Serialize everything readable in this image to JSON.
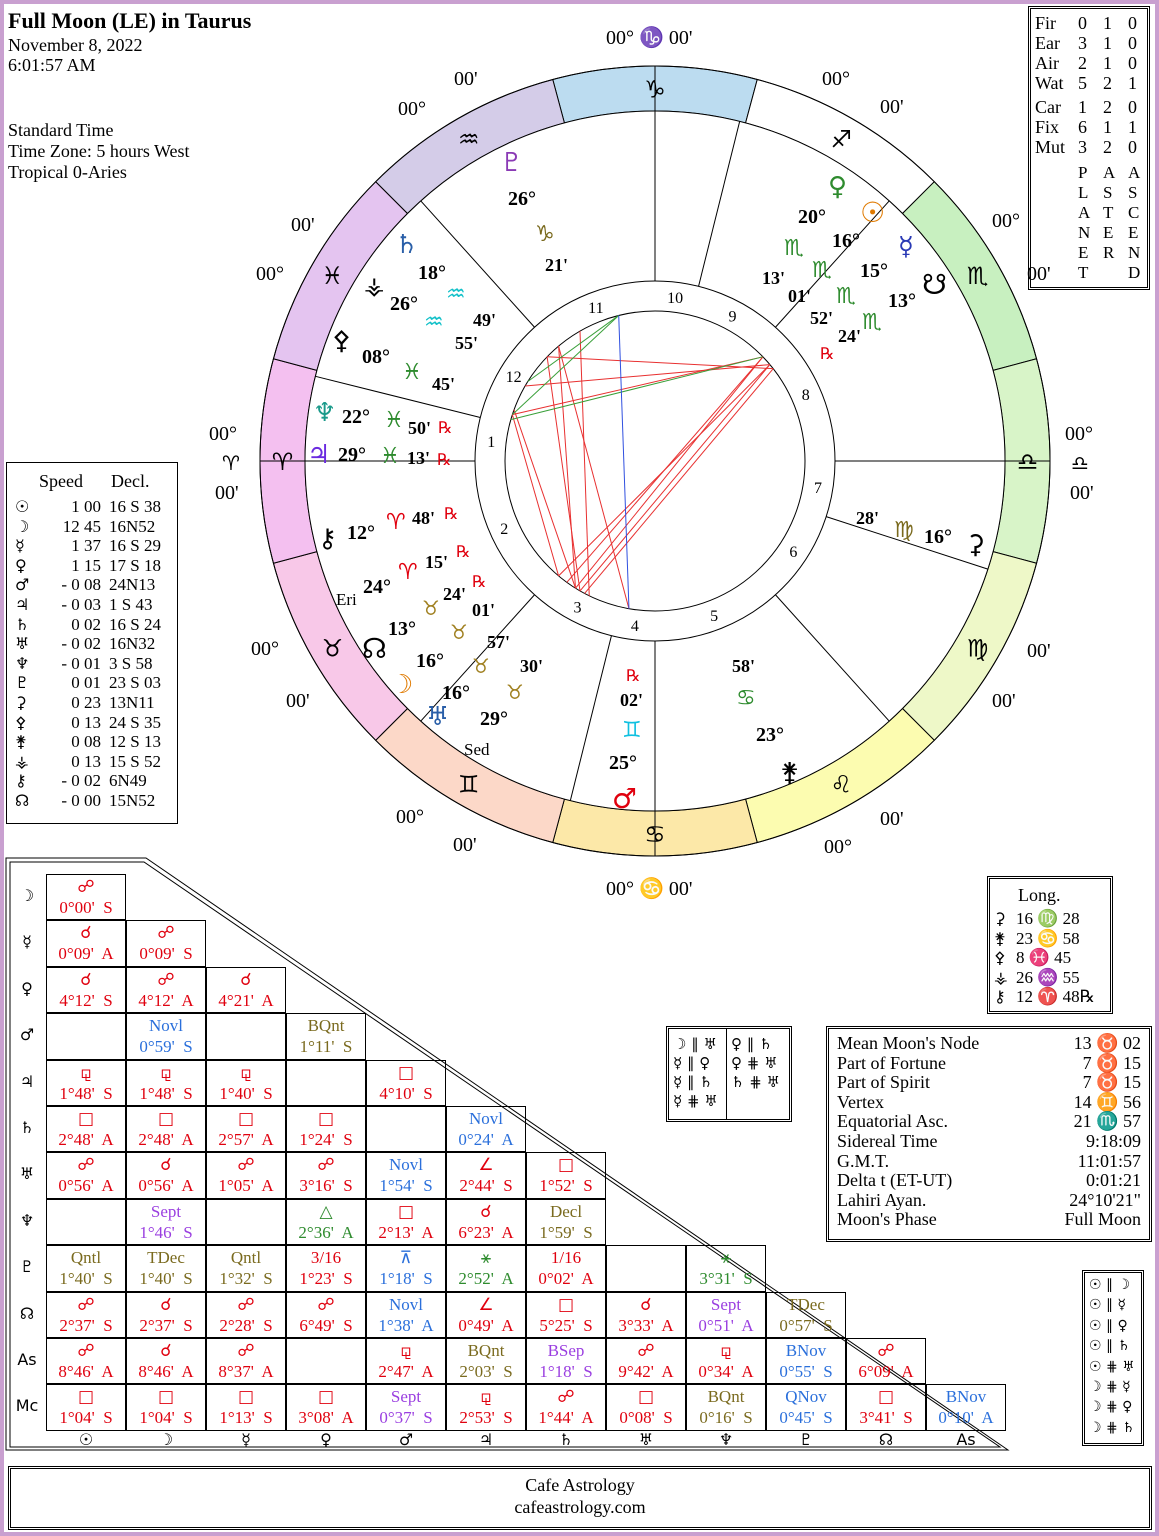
{
  "header": {
    "title": "Full Moon (LE)  in Taurus",
    "date": "November 8, 2022",
    "time": "6:01:57 AM",
    "standard": "Standard Time",
    "zone": "Time Zone: 5 hours West",
    "zodiac": "Tropical 0-Aries"
  },
  "elements_table": {
    "rows": [
      {
        "label": "Fir",
        "a": "0",
        "b": "1",
        "c": "0"
      },
      {
        "label": "Ear",
        "a": "3",
        "b": "1",
        "c": "0"
      },
      {
        "label": "Air",
        "a": "2",
        "b": "1",
        "c": "0"
      },
      {
        "label": "Wat",
        "a": "5",
        "b": "2",
        "c": "1"
      },
      {
        "label": "Car",
        "a": "1",
        "b": "2",
        "c": "0"
      },
      {
        "label": "Fix",
        "a": "6",
        "b": "1",
        "c": "1"
      },
      {
        "label": "Mut",
        "a": "3",
        "b": "2",
        "c": "0"
      }
    ],
    "col_a": "PLANET",
    "col_b": "ASTER",
    "col_c": "ASCEND"
  },
  "speed_table": {
    "head_speed": "Speed",
    "head_decl": "Decl.",
    "rows": [
      {
        "sym": "☉",
        "speed": "1 00",
        "decl": "16 S 38"
      },
      {
        "sym": "☽",
        "speed": "12 45",
        "decl": "16N52"
      },
      {
        "sym": "☿",
        "speed": "1 37",
        "decl": "16 S 29"
      },
      {
        "sym": "♀",
        "speed": "1 15",
        "decl": "17 S 18"
      },
      {
        "sym": "♂",
        "speed": "- 0 08",
        "decl": "24N13"
      },
      {
        "sym": "♃",
        "speed": "- 0 03",
        "decl": "1 S 43"
      },
      {
        "sym": "♄",
        "speed": "0 02",
        "decl": "16 S 24"
      },
      {
        "sym": "♅",
        "speed": "- 0 02",
        "decl": "16N32"
      },
      {
        "sym": "♆",
        "speed": "- 0 01",
        "decl": "3 S 58"
      },
      {
        "sym": "♇",
        "speed": "0 01",
        "decl": "23 S 03"
      },
      {
        "sym": "⚳",
        "speed": "0 23",
        "decl": "13N11"
      },
      {
        "sym": "⚴",
        "speed": "0 13",
        "decl": "24 S 35"
      },
      {
        "sym": "⚵",
        "speed": "0 08",
        "decl": "12 S 13"
      },
      {
        "sym": "⚶",
        "speed": "0 13",
        "decl": "15 S 52"
      },
      {
        "sym": "⚷",
        "speed": "- 0 02",
        "decl": "6N49"
      },
      {
        "sym": "☊",
        "speed": "- 0 00",
        "decl": "15N52"
      }
    ]
  },
  "wheel": {
    "signs": [
      "♑",
      "♐",
      "♏",
      "♎",
      "♍",
      "♌",
      "♋",
      "♊",
      "♉",
      "♈",
      "♓",
      "♒"
    ],
    "rim": {
      "top": "00° ♑ 00'",
      "bottom": "00° ♋ 00'",
      "left_a": "00°",
      "left_b": "00'",
      "right_a": "00°",
      "right_b": "00'",
      "left_sym": "♈",
      "right_sym": "♎",
      "sag_a": "00°",
      "sag_b": "00'",
      "sco_a": "00°",
      "sco_b": "00'",
      "aqu_a": "00'",
      "aqu_b": "00°",
      "pis_a": "00'",
      "pis_b": "00°",
      "vir_a": "00'",
      "vir_b": "00'",
      "tau_a": "00°",
      "tau_b": "00'",
      "gem_a": "00°",
      "gem_b": "00'",
      "leo_a": "00°",
      "leo_b": "00'"
    },
    "houses": [
      "10",
      "9",
      "8",
      "7",
      "6",
      "5",
      "4",
      "3",
      "2",
      "1",
      "12",
      "11"
    ],
    "labels": {
      "pluto_deg": "26°",
      "pluto_min": "21'",
      "saturn_deg": "18°",
      "saturn_min": "49'",
      "vesta_deg": "26°",
      "vesta_min": "55'",
      "pallas_deg": "08°",
      "pallas_min": "45'",
      "neptune_deg": "22°",
      "neptune_min": "50'",
      "jupiter_deg": "29°",
      "jupiter_min": "13'",
      "chiron_deg": "12°",
      "chiron_min": "48'",
      "eris_label": "Eri",
      "eris_deg": "24°",
      "eris_min": "15'",
      "node_deg": "13°",
      "node_min": "01'",
      "moon_deg": "16°",
      "moon_min": "57'",
      "uranus_deg": "16°",
      "uranus_min": "30'",
      "sed_deg": "29°",
      "sed_label": "Sed",
      "mars_deg": "25°",
      "mars_min": "02'",
      "juno_deg": "23°",
      "juno_min": "58'",
      "ceres_deg": "16°",
      "ceres_min": "28'",
      "venus_deg": "20°",
      "venus_min": "13'",
      "sun_deg": "16°",
      "sun_min": "01'",
      "mercury_deg": "15°",
      "mercury_min": "52'",
      "snode_deg": "13°",
      "snode_min": "24'",
      "north_node_sym": "☊",
      "chiron_eris_24": "24'"
    }
  },
  "longitude_box": {
    "title": "Long.",
    "rows": [
      {
        "sym": "⚳",
        "val": "16 ♍ 28"
      },
      {
        "sym": "⚵",
        "val": "23 ♋ 58"
      },
      {
        "sym": "⚴",
        "val": "8 ♓ 45"
      },
      {
        "sym": "⚶",
        "val": "26 ♒ 55"
      },
      {
        "sym": "⚷",
        "val": "12 ♈ 48℞"
      }
    ]
  },
  "parallels_box": {
    "left": [
      "☽ ∥ ♅",
      "☿ ∥ ♀",
      "☿ ∥ ♄",
      "☿ ⋕ ♅"
    ],
    "right": [
      "♀ ∥ ♄",
      "♀ ⋕ ♅",
      "♄ ⋕ ♅"
    ]
  },
  "points_box": {
    "rows": [
      {
        "label": "Mean Moon's Node",
        "val": "13 ♉ 02"
      },
      {
        "label": "Part of Fortune",
        "val": "7 ♉ 15"
      },
      {
        "label": "Part of Spirit",
        "val": "7 ♉ 15"
      },
      {
        "label": "Vertex",
        "val": "14 ♊ 56"
      },
      {
        "label": "Equatorial Asc.",
        "val": "21 ♏ 57"
      },
      {
        "label": "Sidereal Time",
        "val": "9:18:09"
      },
      {
        "label": "G.M.T.",
        "val": "11:01:57"
      },
      {
        "label": "Delta t (ET-UT)",
        "val": "0:01:21"
      },
      {
        "label": "Lahiri Ayan.",
        "val": "24°10'21\""
      },
      {
        "label": "Moon's Phase",
        "val": "Full Moon"
      }
    ]
  },
  "sun_parallels": [
    "☉ ∥ ☽",
    "☉ ∥ ☿",
    "☉ ∥ ♀",
    "☉ ∥ ♄",
    "☉ ⋕ ♅",
    "☽ ⋕ ☿",
    "☽ ⋕ ♀",
    "☽ ⋕ ♄"
  ],
  "aspect_grid": {
    "row_labels": [
      "☽",
      "☿",
      "♀",
      "♂",
      "♃",
      "♄",
      "♅",
      "♆",
      "♇",
      "☊",
      "As",
      "Mc"
    ],
    "col_labels": [
      "☉",
      "☽",
      "☿",
      "♀",
      "♂",
      "♃",
      "♄",
      "♅",
      "♆",
      "♇",
      "☊",
      "As"
    ],
    "rows": [
      [
        {
          "g": "☍",
          "v": "0°00'  S",
          "c": "red"
        }
      ],
      [
        {
          "g": "☌",
          "v": "0°09'  A",
          "c": "red"
        },
        {
          "g": "☍",
          "v": "0°09'  S",
          "c": "red"
        }
      ],
      [
        {
          "g": "☌",
          "v": "4°12'  S",
          "c": "red"
        },
        {
          "g": "☍",
          "v": "4°12'  A",
          "c": "red"
        },
        {
          "g": "☌",
          "v": "4°21'  A",
          "c": "red"
        }
      ],
      [
        {
          "g": "",
          "v": "",
          "c": ""
        },
        {
          "g": "Novl",
          "v": "0°59'  S",
          "c": "blue"
        },
        {
          "g": "",
          "v": "",
          "c": ""
        },
        {
          "g": "BQnt",
          "v": "1°11'  S",
          "c": "olive"
        }
      ],
      [
        {
          "g": "⚼",
          "v": "1°48'  S",
          "c": "red"
        },
        {
          "g": "⚼",
          "v": "1°48'  S",
          "c": "red"
        },
        {
          "g": "⚼",
          "v": "1°40'  S",
          "c": "red"
        },
        {
          "g": "",
          "v": "",
          "c": ""
        },
        {
          "g": "□",
          "v": "4°10'  S",
          "c": "red"
        }
      ],
      [
        {
          "g": "□",
          "v": "2°48'  A",
          "c": "red"
        },
        {
          "g": "□",
          "v": "2°48'  A",
          "c": "red"
        },
        {
          "g": "□",
          "v": "2°57'  A",
          "c": "red"
        },
        {
          "g": "□",
          "v": "1°24'  S",
          "c": "red"
        },
        {
          "g": "",
          "v": "",
          "c": ""
        },
        {
          "g": "Novl",
          "v": "0°24'  A",
          "c": "blue"
        }
      ],
      [
        {
          "g": "☍",
          "v": "0°56'  A",
          "c": "red"
        },
        {
          "g": "☌",
          "v": "0°56'  A",
          "c": "red"
        },
        {
          "g": "☍",
          "v": "1°05'  A",
          "c": "red"
        },
        {
          "g": "☍",
          "v": "3°16'  S",
          "c": "red"
        },
        {
          "g": "Novl",
          "v": "1°54'  S",
          "c": "blue"
        },
        {
          "g": "∠",
          "v": "2°44'  S",
          "c": "red"
        },
        {
          "g": "□",
          "v": "1°52'  S",
          "c": "red"
        }
      ],
      [
        {
          "g": "",
          "v": "",
          "c": ""
        },
        {
          "g": "Sept",
          "v": "1°46'  S",
          "c": "purple"
        },
        {
          "g": "",
          "v": "",
          "c": ""
        },
        {
          "g": "△",
          "v": "2°36'  A",
          "c": "green"
        },
        {
          "g": "□",
          "v": "2°13'  A",
          "c": "red"
        },
        {
          "g": "☌",
          "v": "6°23'  A",
          "c": "red"
        },
        {
          "g": "Decl",
          "v": "1°59'  S",
          "c": "olive"
        }
      ],
      [
        {
          "g": "Qntl",
          "v": "1°40'  S",
          "c": "olive"
        },
        {
          "g": "TDec",
          "v": "1°40'  S",
          "c": "olive"
        },
        {
          "g": "Qntl",
          "v": "1°32'  S",
          "c": "olive"
        },
        {
          "g": "3/16",
          "v": "1°23'  S",
          "c": "red"
        },
        {
          "g": "⊼",
          "v": "1°18'  S",
          "c": "blue"
        },
        {
          "g": "⚹",
          "v": "2°52'  A",
          "c": "green"
        },
        {
          "g": "1/16",
          "v": "0°02'  A",
          "c": "red"
        },
        {
          "g": "",
          "v": "",
          "c": ""
        },
        {
          "g": "⚹",
          "v": "3°31'  S",
          "c": "green"
        }
      ],
      [
        {
          "g": "☍",
          "v": "2°37'  S",
          "c": "red"
        },
        {
          "g": "☌",
          "v": "2°37'  S",
          "c": "red"
        },
        {
          "g": "☍",
          "v": "2°28'  S",
          "c": "red"
        },
        {
          "g": "☍",
          "v": "6°49'  S",
          "c": "red"
        },
        {
          "g": "Novl",
          "v": "1°38'  A",
          "c": "blue"
        },
        {
          "g": "∠",
          "v": "0°49'  A",
          "c": "red"
        },
        {
          "g": "□",
          "v": "5°25'  S",
          "c": "red"
        },
        {
          "g": "☌",
          "v": "3°33'  A",
          "c": "red"
        },
        {
          "g": "Sept",
          "v": "0°51'  A",
          "c": "purple"
        },
        {
          "g": "TDec",
          "v": "0°57'  S",
          "c": "olive"
        }
      ],
      [
        {
          "g": "☍",
          "v": "8°46'  A",
          "c": "red"
        },
        {
          "g": "☌",
          "v": "8°46'  A",
          "c": "red"
        },
        {
          "g": "☍",
          "v": "8°37'  A",
          "c": "red"
        },
        {
          "g": "",
          "v": "",
          "c": ""
        },
        {
          "g": "⚼",
          "v": "2°47'  A",
          "c": "red"
        },
        {
          "g": "BQnt",
          "v": "2°03'  S",
          "c": "olive"
        },
        {
          "g": "BSep",
          "v": "1°18'  S",
          "c": "purple"
        },
        {
          "g": "☍",
          "v": "9°42'  A",
          "c": "red"
        },
        {
          "g": "⚼",
          "v": "0°34'  A",
          "c": "red"
        },
        {
          "g": "BNov",
          "v": "0°55'  S",
          "c": "blue"
        },
        {
          "g": "☍",
          "v": "6°09'  A",
          "c": "red"
        }
      ],
      [
        {
          "g": "□",
          "v": "1°04'  S",
          "c": "red"
        },
        {
          "g": "□",
          "v": "1°04'  S",
          "c": "red"
        },
        {
          "g": "□",
          "v": "1°13'  S",
          "c": "red"
        },
        {
          "g": "□",
          "v": "3°08'  A",
          "c": "red"
        },
        {
          "g": "Sept",
          "v": "0°37'  S",
          "c": "purple"
        },
        {
          "g": "⚼",
          "v": "2°53'  S",
          "c": "red"
        },
        {
          "g": "☍",
          "v": "1°44'  A",
          "c": "red"
        },
        {
          "g": "□",
          "v": "0°08'  S",
          "c": "red"
        },
        {
          "g": "BQnt",
          "v": "0°16'  S",
          "c": "olive"
        },
        {
          "g": "QNov",
          "v": "0°45'  S",
          "c": "blue"
        },
        {
          "g": "□",
          "v": "3°41'  S",
          "c": "red"
        },
        {
          "g": "BNov",
          "v": "0°10'  A",
          "c": "blue"
        }
      ]
    ]
  },
  "footer": {
    "line1": "Cafe Astrology",
    "line2": "cafeastrology.com"
  }
}
